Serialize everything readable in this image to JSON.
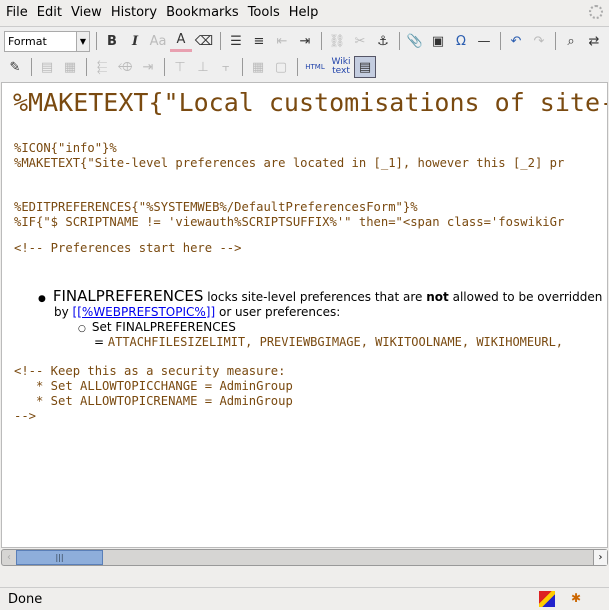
{
  "menu": [
    "File",
    "Edit",
    "View",
    "History",
    "Bookmarks",
    "Tools",
    "Help"
  ],
  "toolbar": {
    "format_label": "Format",
    "row1": [
      {
        "name": "bold",
        "glyph": "B"
      },
      {
        "name": "italic",
        "glyph": "I"
      },
      {
        "name": "font-size",
        "glyph": "Aa",
        "disabled": true
      },
      {
        "name": "text-color",
        "glyph": "A"
      },
      {
        "name": "remove-format",
        "glyph": "⌫"
      },
      {
        "sep": true
      },
      {
        "name": "bullet-list",
        "glyph": "☰"
      },
      {
        "name": "numbered-list",
        "glyph": "≡"
      },
      {
        "name": "outdent",
        "glyph": "⇤",
        "disabled": true
      },
      {
        "name": "indent",
        "glyph": "⇥"
      },
      {
        "sep": true
      },
      {
        "name": "link",
        "glyph": "⛓",
        "disabled": true
      },
      {
        "name": "unlink",
        "glyph": "✂",
        "disabled": true
      },
      {
        "name": "anchor",
        "glyph": "⚓"
      },
      {
        "sep": true
      },
      {
        "name": "attach",
        "glyph": "📎"
      },
      {
        "name": "image",
        "glyph": "▣"
      },
      {
        "name": "special-char",
        "glyph": "Ω"
      },
      {
        "name": "horizontal-rule",
        "glyph": "—"
      },
      {
        "sep": true
      },
      {
        "name": "undo",
        "glyph": "↶"
      },
      {
        "name": "redo",
        "glyph": "↷",
        "disabled": true
      },
      {
        "sep": true
      },
      {
        "name": "find",
        "glyph": "⌕"
      },
      {
        "name": "replace",
        "glyph": "⇄"
      }
    ],
    "row2": [
      {
        "name": "edit-source",
        "glyph": "✎"
      },
      {
        "sep": true
      },
      {
        "name": "table-props",
        "glyph": "▤",
        "disabled": true
      },
      {
        "name": "cell-props",
        "glyph": "▦",
        "disabled": true
      },
      {
        "sep": true
      },
      {
        "name": "insert-row-before",
        "glyph": "⬱",
        "disabled": true
      },
      {
        "name": "insert-row-after",
        "glyph": "⬲",
        "disabled": true
      },
      {
        "name": "delete-row",
        "glyph": "⇥",
        "disabled": true
      },
      {
        "sep": true
      },
      {
        "name": "insert-col-before",
        "glyph": "⊤",
        "disabled": true
      },
      {
        "name": "insert-col-after",
        "glyph": "⊥",
        "disabled": true
      },
      {
        "name": "delete-col",
        "glyph": "⫟",
        "disabled": true
      },
      {
        "sep": true
      },
      {
        "name": "insert-table",
        "glyph": "▦",
        "disabled": true
      },
      {
        "name": "merge-cells",
        "glyph": "▢",
        "disabled": true
      },
      {
        "sep": true
      },
      {
        "name": "html",
        "glyph": "HTML"
      },
      {
        "name": "wikitext",
        "glyph": "Wiki text"
      },
      {
        "name": "fullscreen",
        "glyph": "▤",
        "active": true
      }
    ]
  },
  "editor": {
    "heading": "%MAKETEXT{\"Local customisations of site-",
    "lines": [
      "%ICON{\"info\"}%",
      "%MAKETEXT{\"Site-level preferences are located in [_1], however this [_2] pr",
      "%EDITPREFERENCES{\"%SYSTEMWEB%/DefaultPreferencesForm\"}%",
      "%IF{\"$ SCRIPTNAME != 'viewauth%SCRIPTSUFFIX%'\" then=\"<span class='foswikiGr",
      "<!-- Preferences start here -->"
    ],
    "bullet": {
      "term": "FINALPREFERENCES",
      "text1": " locks site-level preferences that are ",
      "bold": "not",
      "text2": " allowed to be overridden",
      "by": "by ",
      "link": "[[%WEBPREFSTOPIC%]]",
      "text3": " or user preferences:"
    },
    "sub": {
      "label": "Set FINALPREFERENCES",
      "eq": "= ",
      "value": "ATTACHFILESIZELIMIT, PREVIEWBGIMAGE, WIKITOOLNAME, WIKIHOMEURL,"
    },
    "comment": [
      "<!-- Keep this as a security measure:",
      "   * Set ALLOWTOPICCHANGE = AdminGroup",
      "   * Set ALLOWTOPICRENAME = AdminGroup",
      "-->"
    ]
  },
  "status": "Done"
}
